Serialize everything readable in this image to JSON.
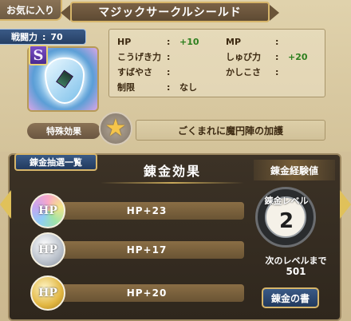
{
  "header": {
    "favorite_label": "お気に入り",
    "item_name": "マジックサークルシールド"
  },
  "item": {
    "power_label": "戦闘力",
    "power_value": "70",
    "rank": "S"
  },
  "stats": [
    {
      "label": "HP",
      "value": "+10",
      "highlight": true
    },
    {
      "label": "MP",
      "value": "",
      "highlight": false
    },
    {
      "label": "こうげき力",
      "value": "",
      "highlight": false
    },
    {
      "label": "しゅび力",
      "value": "+20",
      "highlight": true
    },
    {
      "label": "すばやさ",
      "value": "",
      "highlight": false
    },
    {
      "label": "かしこさ",
      "value": "",
      "highlight": false
    },
    {
      "label": "制限",
      "value": "なし",
      "highlight": false
    }
  ],
  "special": {
    "label": "特殊効果",
    "text": "ごくまれに魔円陣の加護"
  },
  "alchemy": {
    "lottery_tab": "錬金抽選一覧",
    "effects_title": "錬金効果",
    "effects": [
      {
        "orb": "HP",
        "orb_type": "rainbow",
        "text": "HP+23"
      },
      {
        "orb": "HP",
        "orb_type": "silver",
        "text": "HP+17"
      },
      {
        "orb": "HP",
        "orb_type": "gold",
        "text": "HP+20"
      }
    ],
    "exp_title": "錬金経験値",
    "level_label": "錬金レベル",
    "level_value": "2",
    "next_label": "次のレベルまで",
    "next_value": "501",
    "book_button": "錬金の書"
  }
}
